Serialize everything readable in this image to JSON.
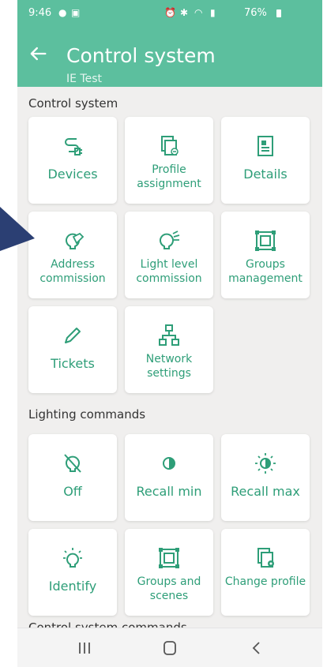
{
  "statusbar": {
    "time": "9:46",
    "battery": "76%"
  },
  "appbar": {
    "title": "Control system",
    "subtitle": "IE Test"
  },
  "sections": {
    "control_system": "Control system",
    "lighting_commands": "Lighting commands",
    "partial_next": "Control system commands"
  },
  "tiles": {
    "devices": "Devices",
    "profile_assignment": "Profile assignment",
    "details": "Details",
    "address_commission": "Address commission",
    "light_level_commission": "Light level commission",
    "groups_management": "Groups management",
    "tickets": "Tickets",
    "network_settings": "Network settings",
    "off": "Off",
    "recall_min": "Recall min",
    "recall_max": "Recall max",
    "identify": "Identify",
    "groups_and_scenes": "Groups and scenes",
    "change_profile": "Change profile"
  },
  "colors": {
    "accent": "#5cbf9e",
    "tile_text": "#2e9e78",
    "background": "#f0efee",
    "pointer": "#2b3f73"
  },
  "icons": [
    "back-arrow-icon",
    "plug-icon",
    "profile-icon",
    "document-icon",
    "bulb-tag-icon",
    "bulb-light-icon",
    "group-box-icon",
    "pencil-icon",
    "network-icon",
    "bulb-off-icon",
    "half-circle-icon",
    "sun-icon",
    "bulb-identify-icon",
    "groups-scenes-icon",
    "change-profile-icon"
  ]
}
